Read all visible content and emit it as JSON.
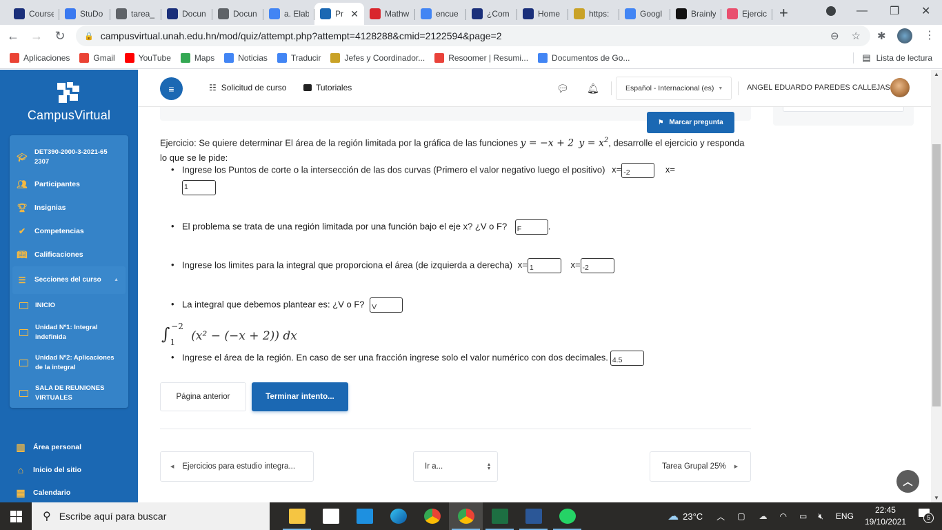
{
  "browser": {
    "tabs": [
      {
        "title": "Course",
        "icon": "shield-star-icon",
        "color": "#1a2f7a"
      },
      {
        "title": "StuDo",
        "icon": "studocu-s-icon",
        "color": "#3a79f0"
      },
      {
        "title": "tarea_",
        "icon": "globe-icon",
        "color": "#5f6368"
      },
      {
        "title": "Docun",
        "icon": "shield-star-icon",
        "color": "#1a2f7a"
      },
      {
        "title": "Docun",
        "icon": "globe-icon",
        "color": "#5f6368"
      },
      {
        "title": "a. Elab",
        "icon": "google-g-icon",
        "color": "#4285f4"
      },
      {
        "title": "Pr",
        "icon": "campusvirtual-icon",
        "color": "#1b68b3",
        "active": true
      },
      {
        "title": "Mathw",
        "icon": "mathway-icon",
        "color": "#d9262c"
      },
      {
        "title": "encue",
        "icon": "google-g-icon",
        "color": "#4285f4"
      },
      {
        "title": "¿Com",
        "icon": "shield-star-icon",
        "color": "#1a2f7a"
      },
      {
        "title": "Home",
        "icon": "shield-star-icon",
        "color": "#1a2f7a"
      },
      {
        "title": "https:",
        "icon": "emblem-icon",
        "color": "#c9a227"
      },
      {
        "title": "Googl",
        "icon": "google-translate-icon",
        "color": "#4285f4"
      },
      {
        "title": "Brainly",
        "icon": "brainly-icon",
        "color": "#111111"
      },
      {
        "title": "Ejercic",
        "icon": "symbolab-icon",
        "color": "#e94f6e"
      }
    ],
    "new_tab": "+",
    "url": "campusvirtual.unah.edu.hn/mod/quiz/attempt.php?attempt=4128288&cmid=2122594&page=2",
    "bookmarks": [
      {
        "label": "Aplicaciones",
        "icon": "apps-grid-icon",
        "color": "#ea4335"
      },
      {
        "label": "Gmail",
        "icon": "gmail-icon",
        "color": "#ea4335"
      },
      {
        "label": "YouTube",
        "icon": "youtube-icon",
        "color": "#ff0000"
      },
      {
        "label": "Maps",
        "icon": "maps-icon",
        "color": "#34a853"
      },
      {
        "label": "Noticias",
        "icon": "news-icon",
        "color": "#4285f4"
      },
      {
        "label": "Traducir",
        "icon": "translate-icon",
        "color": "#4285f4"
      },
      {
        "label": "Jefes y Coordinador...",
        "icon": "emblem-icon",
        "color": "#c9a227"
      },
      {
        "label": "Resoomer | Resumi...",
        "icon": "resoomer-icon",
        "color": "#e9423a"
      },
      {
        "label": "Documentos de Go...",
        "icon": "google-docs-icon",
        "color": "#4285f4"
      }
    ],
    "reading_list": "Lista de lectura"
  },
  "sidebar": {
    "brand": "CampusVirtual",
    "course_items": [
      {
        "label": "DET390-2000-3-2021-652307",
        "icon": "graduation-cap-icon"
      },
      {
        "label": "Participantes",
        "icon": "users-icon"
      },
      {
        "label": "Insignias",
        "icon": "trophy-icon"
      },
      {
        "label": "Competencias",
        "icon": "check-icon"
      },
      {
        "label": "Calificaciones",
        "icon": "book-icon"
      }
    ],
    "sections_label": "Secciones del curso",
    "sections": [
      {
        "label": "INICIO"
      },
      {
        "label": "Unidad Nº1: Integral indefinida"
      },
      {
        "label": "Unidad Nº2: Aplicaciones de la integral"
      },
      {
        "label": "SALA DE REUNIONES VIRTUALES"
      }
    ],
    "bottom_items": [
      {
        "label": "Área personal",
        "icon": "dashboard-icon"
      },
      {
        "label": "Inicio del sitio",
        "icon": "home-icon"
      },
      {
        "label": "Calendario",
        "icon": "calendar-icon"
      }
    ]
  },
  "header": {
    "links": [
      {
        "label": "Solicitud de curso",
        "icon": "list-check-icon"
      },
      {
        "label": "Tutoriales",
        "icon": "video-icon"
      }
    ],
    "language": "Español - Internacional (es)",
    "user_name": "ANGEL EDUARDO PAREDES CALLEJAS"
  },
  "question": {
    "flag_label": "Marcar pregunta",
    "intro_before": "Ejercicio: Se quiere determinar El área de la región limitada por la gráfica de las funciones ",
    "f1": "y = −x + 2",
    "f2": "y = x",
    "f2_exp": "2",
    "intro_after": ", desarrolle el ejercicio y responda lo que se le pide:",
    "items": [
      {
        "text": "Ingrese los Puntos de corte o la intersección de las dos curvas (Primero el valor negativo luego el positivo)",
        "prefix1": "x=",
        "answer1": "-2",
        "prefix2": "x=",
        "answer2": "1"
      },
      {
        "text": "El problema se trata de una región limitada por una función bajo el eje x? ¿V o F?",
        "answer": "F",
        "suffix": "."
      },
      {
        "text": "Ingrese los limites para la integral que proporciona el área (de izquierda a derecha)",
        "prefix1": "x=",
        "answer1": "1",
        "prefix2": "x=",
        "answer2": "-2"
      },
      {
        "text": "La integral que debemos plantear es:  ¿V o F?",
        "answer": "V"
      },
      {
        "text": "Ingrese el área de la región. En caso de ser una fracción ingrese solo el valor numérico con dos decimales.",
        "answer": "4.5"
      }
    ],
    "integral": {
      "lower": "1",
      "upper": "−2",
      "body": "(x² − (−x + 2)) dx"
    }
  },
  "actions": {
    "previous_page": "Página anterior",
    "finish_attempt": "Terminar intento..."
  },
  "activity_nav": {
    "prev_activity": "Ejercicios para estudio integra...",
    "jump_to": "Ir a...",
    "next_activity": "Tarea Grupal 25%"
  },
  "taskbar": {
    "search_placeholder": "Escribe aquí para buscar",
    "apps": [
      "file-explorer-icon",
      "microsoft-store-icon",
      "mail-icon",
      "edge-icon",
      "chrome-icon",
      "chrome-profile-icon",
      "excel-icon",
      "word-icon",
      "whatsapp-icon"
    ],
    "weather": "23°C",
    "language": "ENG",
    "time": "22:45",
    "date": "19/10/2021",
    "notifications": "5"
  }
}
